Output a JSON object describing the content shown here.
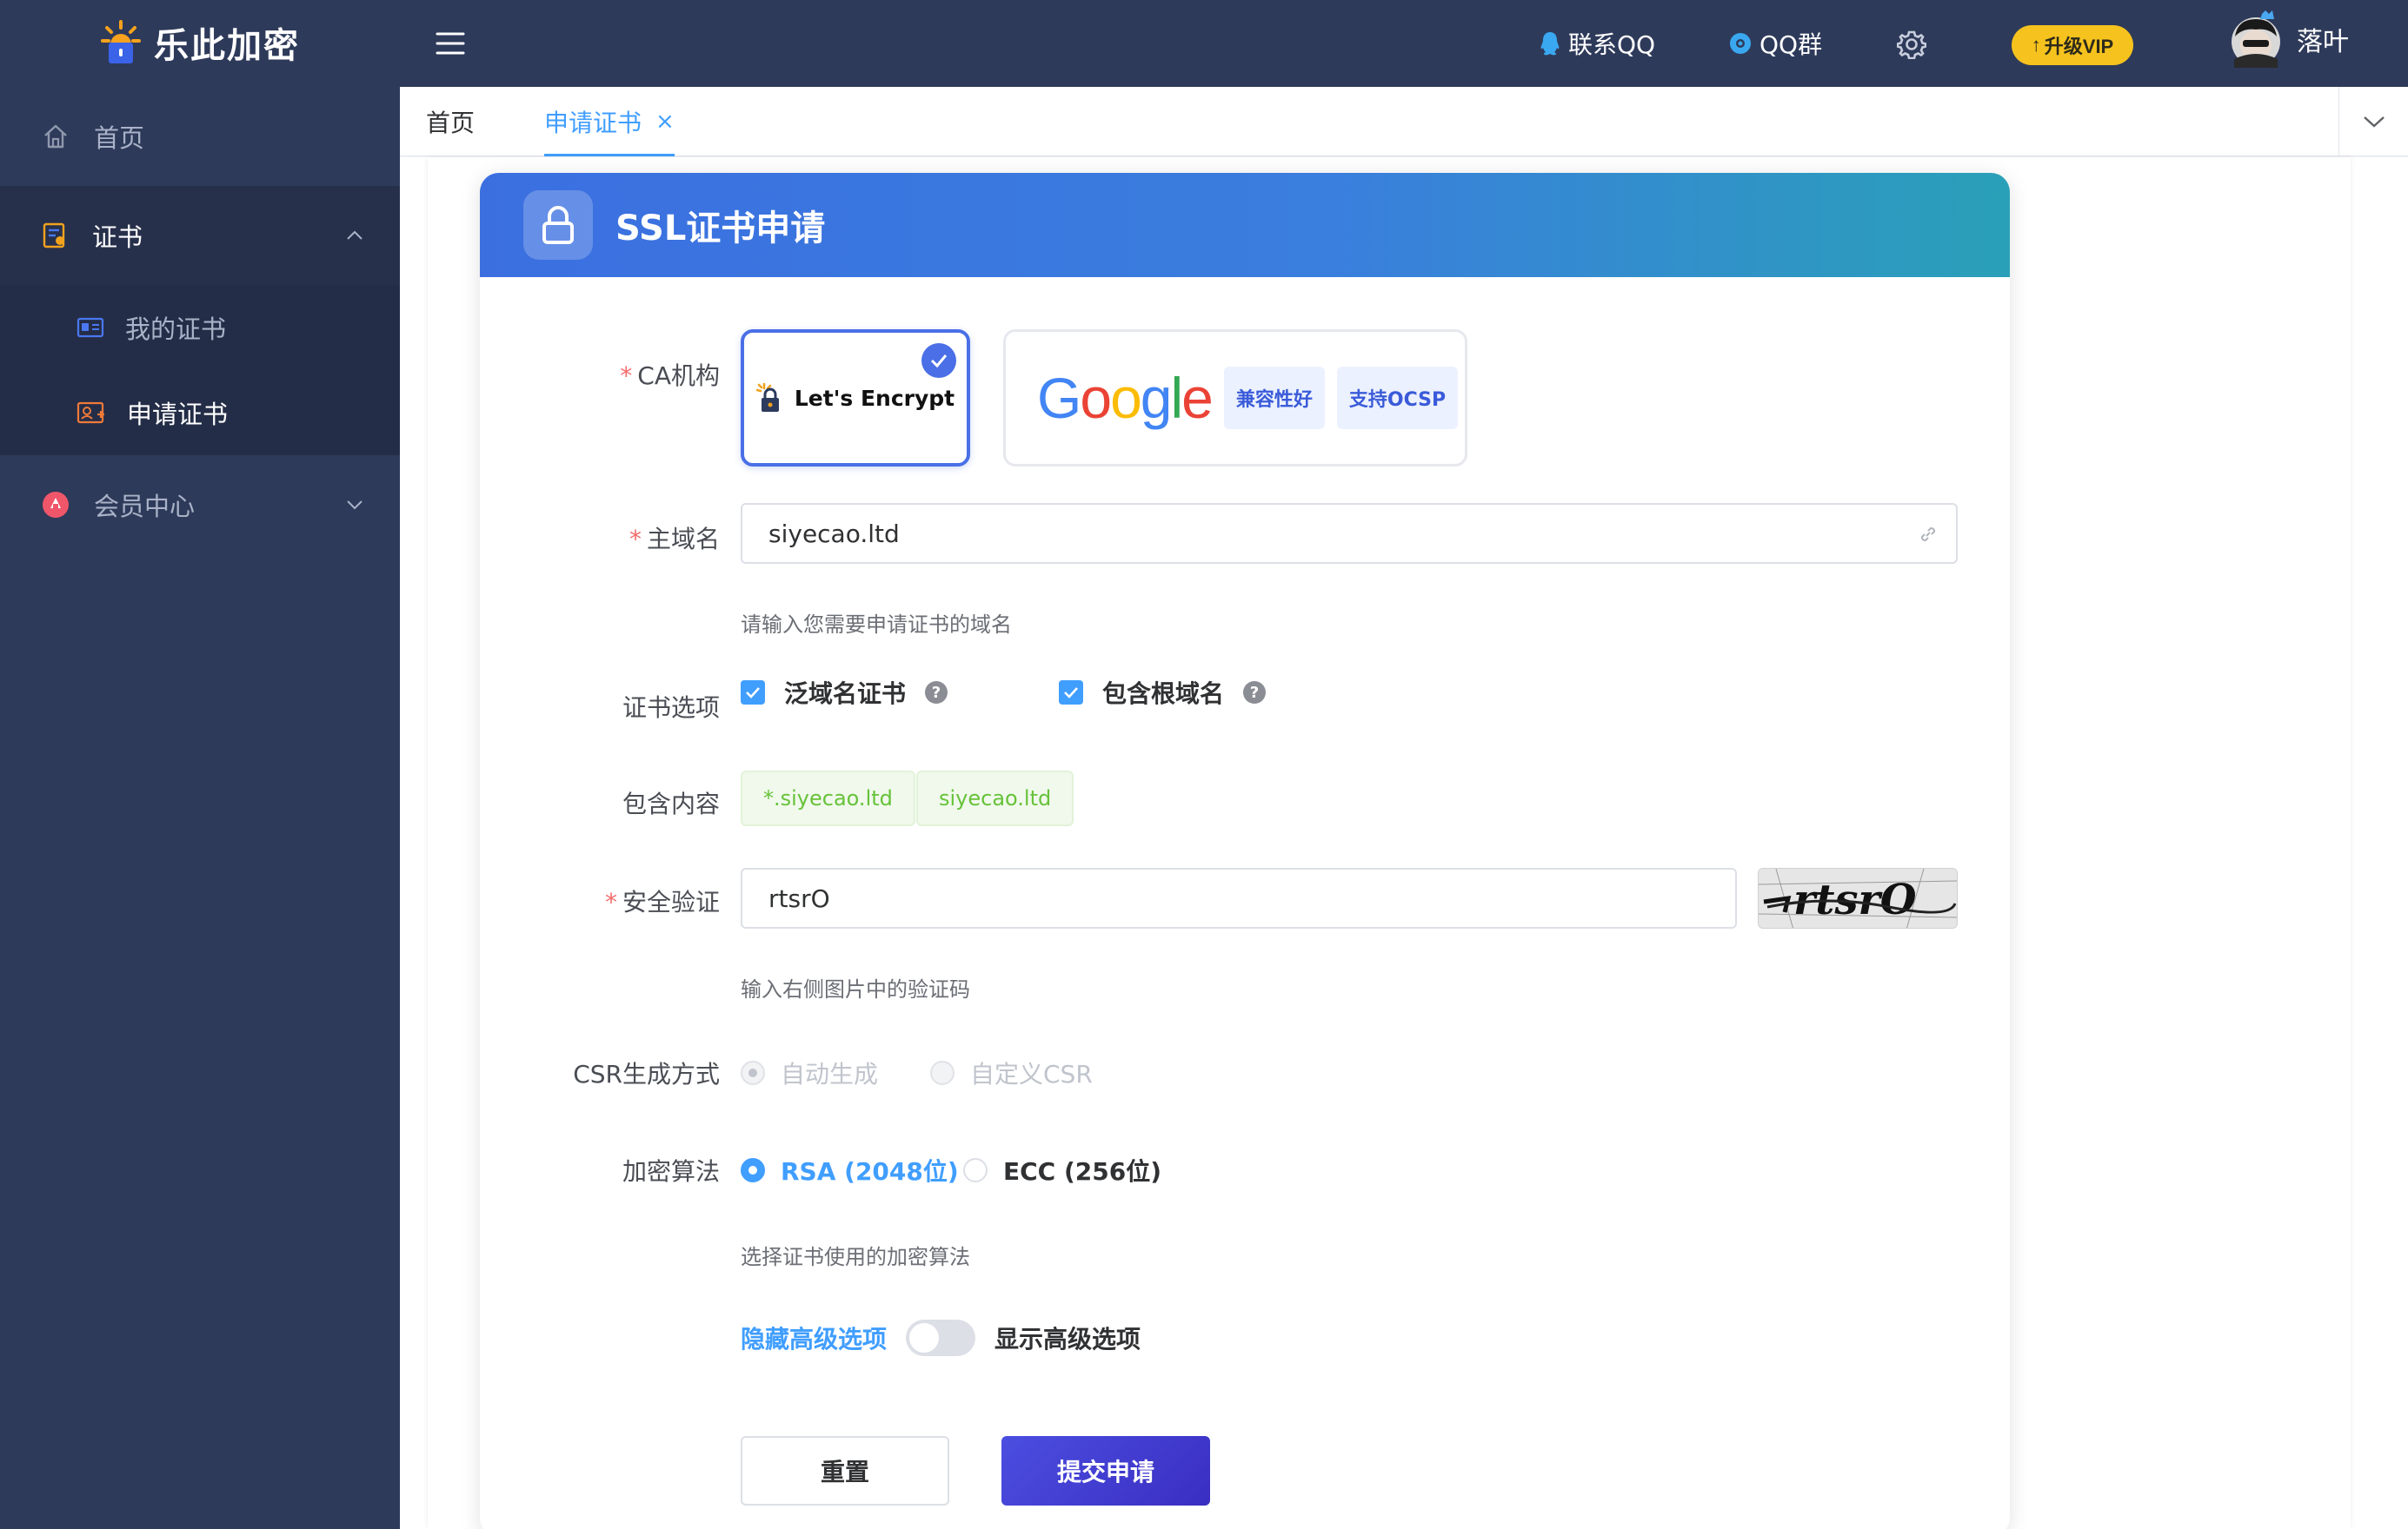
{
  "app": {
    "title": "乐此加密"
  },
  "topbar": {
    "qq_label": "联系QQ",
    "group_label": "QQ群",
    "vip_label": "升级VIP",
    "username": "落叶"
  },
  "sidebar": {
    "items": [
      {
        "label": "首页"
      },
      {
        "label": "证书"
      },
      {
        "label": "我的证书"
      },
      {
        "label": "申请证书"
      },
      {
        "label": "会员中心"
      }
    ]
  },
  "tabs": [
    {
      "label": "首页"
    },
    {
      "label": "申请证书"
    }
  ],
  "form": {
    "title": "SSL证书申请",
    "ca": {
      "label": "CA机构",
      "options": [
        {
          "name": "Let's Encrypt",
          "selected": true
        },
        {
          "name": "Google",
          "tags": [
            "兼容性好",
            "支持OCSP"
          ]
        }
      ]
    },
    "domain": {
      "label": "主域名",
      "value": "siyecao.ltd",
      "hint": "请输入您需要申请证书的域名"
    },
    "options": {
      "label": "证书选项",
      "wildcard_label": "泛域名证书",
      "root_label": "包含根域名"
    },
    "contents": {
      "label": "包含内容",
      "items": [
        "*.siyecao.ltd",
        "siyecao.ltd"
      ]
    },
    "captcha": {
      "label": "安全验证",
      "value": "rtsrO",
      "image_text": "rtsrO",
      "hint": "输入右侧图片中的验证码"
    },
    "csr": {
      "label": "CSR生成方式",
      "options": [
        "自动生成",
        "自定义CSR"
      ]
    },
    "algorithm": {
      "label": "加密算法",
      "options": [
        "RSA (2048位)",
        "ECC (256位)"
      ],
      "hint": "选择证书使用的加密算法"
    },
    "advanced": {
      "hide_label": "隐藏高级选项",
      "show_label": "显示高级选项"
    },
    "buttons": {
      "reset": "重置",
      "submit": "提交申请"
    }
  },
  "colors": {
    "sidebar_bg": "#2e3a5a",
    "primary": "#409eff",
    "brand_blue": "#4a6fe6",
    "vip": "#f6c31e",
    "tag_green": "#67c23a"
  }
}
